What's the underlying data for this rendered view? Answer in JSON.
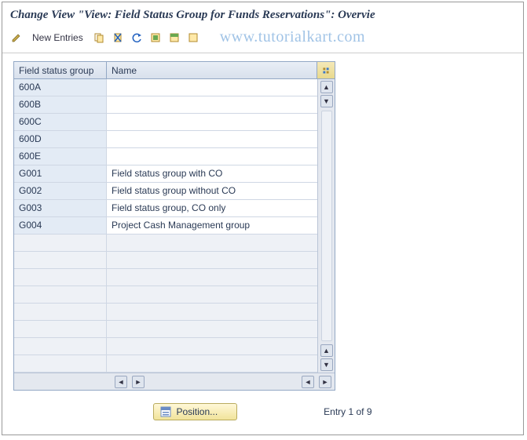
{
  "title": "Change View \"View: Field Status Group for Funds Reservations\": Overvie",
  "toolbar": {
    "new_entries_label": "New Entries"
  },
  "watermark": "www.tutorialkart.com",
  "table": {
    "col_code": "Field status group",
    "col_name": "Name",
    "rows": [
      {
        "code": "600A",
        "name": ""
      },
      {
        "code": "600B",
        "name": ""
      },
      {
        "code": "600C",
        "name": ""
      },
      {
        "code": "600D",
        "name": ""
      },
      {
        "code": "600E",
        "name": ""
      },
      {
        "code": "G001",
        "name": "Field status group with CO"
      },
      {
        "code": "G002",
        "name": "Field status group without CO"
      },
      {
        "code": "G003",
        "name": "Field status group, CO only"
      },
      {
        "code": "G004",
        "name": "Project Cash Management group"
      }
    ],
    "blank_rows": 8
  },
  "footer": {
    "position_label": "Position...",
    "entry_text": "Entry 1 of 9"
  }
}
